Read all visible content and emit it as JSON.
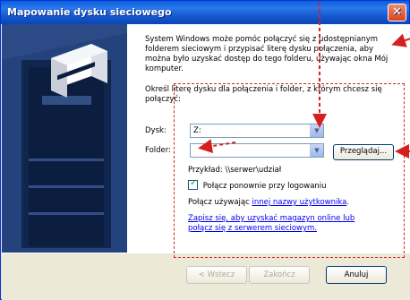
{
  "window": {
    "title": "Mapowanie dysku sieciowego",
    "close_glyph": "✕"
  },
  "intro": {
    "description": "System Windows może pomóc połączyć się z udostępnianym folderem sieciowym i przypisać literę dysku połączenia, aby można było uzyskać dostęp do tego folderu, używając okna Mój komputer.",
    "instruction": "Określ literę dysku dla połączenia i folder, z którym chcesz się połączyć:"
  },
  "drive": {
    "label": "Dysk:",
    "value": "Z:"
  },
  "folder": {
    "label": "Folder:",
    "value": ""
  },
  "browse_label": "Przeglądaj...",
  "example_text": "Przykład: \\\\serwer\\udział",
  "reconnect": {
    "label": "Połącz ponownie przy logowaniu",
    "checked": true
  },
  "connect_as": {
    "prefix": "Połącz używając ",
    "link": "innej nazwy użytkownika",
    "suffix": "."
  },
  "storage_link": "Zapisz się, aby uzyskać magazyn online lub połącz się z serwerem sieciowym.",
  "buttons": {
    "back": "< Wstecz",
    "finish": "Zakończ",
    "cancel": "Anuluj"
  },
  "colors": {
    "titlebar": "#0a5fdb",
    "annotation": "#d62020",
    "link": "#0000ee",
    "side_panel": "#2b4a86"
  },
  "icons": {
    "close": "close-icon",
    "network_drive": "network-drive-icon",
    "dropdown": "chevron-down-icon"
  }
}
